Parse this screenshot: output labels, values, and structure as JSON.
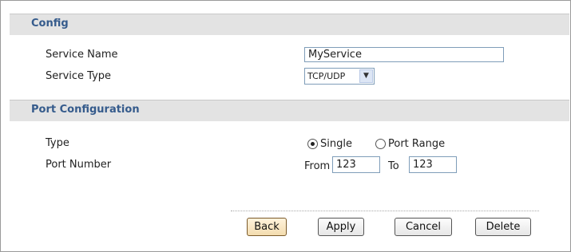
{
  "config": {
    "header": "Config",
    "service_name_label": "Service Name",
    "service_name_value": "MyService",
    "service_type_label": "Service Type",
    "service_type_value": "TCP/UDP"
  },
  "port_config": {
    "header": "Port Configuration",
    "type_label": "Type",
    "radio_single": "Single",
    "radio_port_range": "Port Range",
    "selected_type": "Single",
    "port_number_label": "Port Number",
    "from_label": "From",
    "from_value": "123",
    "to_label": "To",
    "to_value": "123"
  },
  "buttons": {
    "back": "Back",
    "apply": "Apply",
    "cancel": "Cancel",
    "delete": "Delete"
  }
}
